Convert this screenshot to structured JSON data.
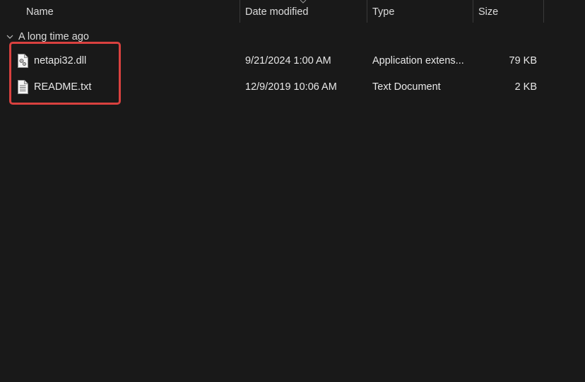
{
  "columns": {
    "name": "Name",
    "date_modified": "Date modified",
    "type": "Type",
    "size": "Size"
  },
  "group": {
    "label": "A long time ago"
  },
  "files": [
    {
      "name": "netapi32.dll",
      "date_modified": "9/21/2024 1:00 AM",
      "type": "Application extens...",
      "size": "79 KB",
      "icon": "dll-file-icon"
    },
    {
      "name": "README.txt",
      "date_modified": "12/9/2019 10:06 AM",
      "type": "Text Document",
      "size": "2 KB",
      "icon": "text-file-icon"
    }
  ],
  "colors": {
    "background": "#191919",
    "highlight": "#d9413f",
    "text": "#e8e8e8"
  }
}
